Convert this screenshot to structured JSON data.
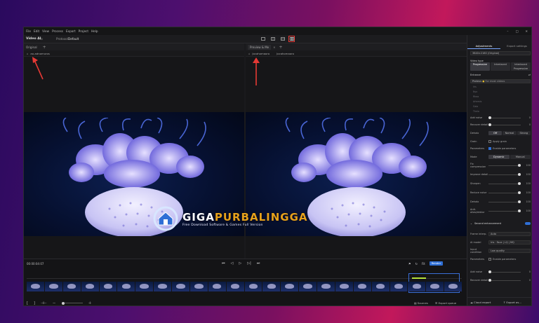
{
  "menu": [
    "File",
    "Edit",
    "View",
    "Process",
    "Export",
    "Project",
    "Help"
  ],
  "toolbar": {
    "app_name": "Video AI",
    "plan": "Pro",
    "breadcrumb_sep": "›",
    "project": "Protocol",
    "preset": "Default"
  },
  "view_modes": [
    "single-view",
    "side-by-side",
    "split-view",
    "comparison-view"
  ],
  "header_right": {
    "presets": "Presets",
    "credits": "7298"
  },
  "left_pane": {
    "tab": "Original",
    "file": "ao-adnomuros"
  },
  "right_pane": {
    "tab": "Preview & Me",
    "file1": "Jocahomaoro",
    "file2": "Jocahomaoro"
  },
  "sidebar": {
    "tab_adjustments": "Adjustments",
    "tab_export": "Export settings",
    "preset_select": "3840×2160 (Original)",
    "video_type_label": "Video type",
    "video_types": [
      "Progressive",
      "Interlaced",
      "Interlaced Progressive"
    ],
    "enhance_label": "Enhance",
    "enhancement_model": "Proteus",
    "enhancement_note": "For most videos",
    "model_items": [
      "Iris",
      "Nyx",
      "Rhea",
      "Artemis",
      "Gaia",
      "Theia"
    ],
    "rows": [
      {
        "label": "Add noise",
        "value": "0"
      },
      {
        "label": "Recover detail",
        "value": "0"
      }
    ],
    "dehalo_label": "Dehalo",
    "auto_seg": [
      "Off",
      "Normal",
      "Strong"
    ],
    "grain_label": "Grain",
    "grain_check": "Apply grain",
    "parameters_label": "Parameters",
    "params_check": "Enable parameters",
    "mode_label": "Mode",
    "mode_opts": [
      "Dynamic",
      "Manual"
    ],
    "sliders": [
      {
        "label": "Fix compression",
        "value": "100"
      },
      {
        "label": "Improve detail",
        "value": "100"
      },
      {
        "label": "Sharpen",
        "value": "100"
      },
      {
        "label": "Reduce noise",
        "value": "100"
      },
      {
        "label": "Dehalo",
        "value": "100"
      },
      {
        "label": "Anti-alias/deblur",
        "value": "100"
      }
    ],
    "second_section": "Second enhancement",
    "field_rows": [
      {
        "label": "Frame interp.",
        "value": "Auto"
      },
      {
        "label": "AI model",
        "value": "Iris · Face | LQ | MQ"
      },
      {
        "label": "Input condition",
        "value": "Low quality"
      }
    ],
    "params2_label": "Parameters",
    "params2_check": "Enable parameters",
    "sliders2": [
      {
        "label": "Add noise",
        "value": "0"
      },
      {
        "label": "Recover detail",
        "value": "0"
      }
    ],
    "cloud_export": "Cloud export",
    "export_btn": "Export as..."
  },
  "timeline": {
    "timecode": "00:00:04:07",
    "zoom": "Fit",
    "render_badge": "Render",
    "sources": "Sources",
    "export_queue": "Export queue"
  },
  "watermark": {
    "brand1": "GIGA",
    "brand2": "PURBALINGGA",
    "tagline": "Free Download Software & Games Full Version"
  },
  "colors": {
    "accent": "#2f6fd6",
    "highlight": "#e53935",
    "watermark_gold": "#e6a11a"
  }
}
